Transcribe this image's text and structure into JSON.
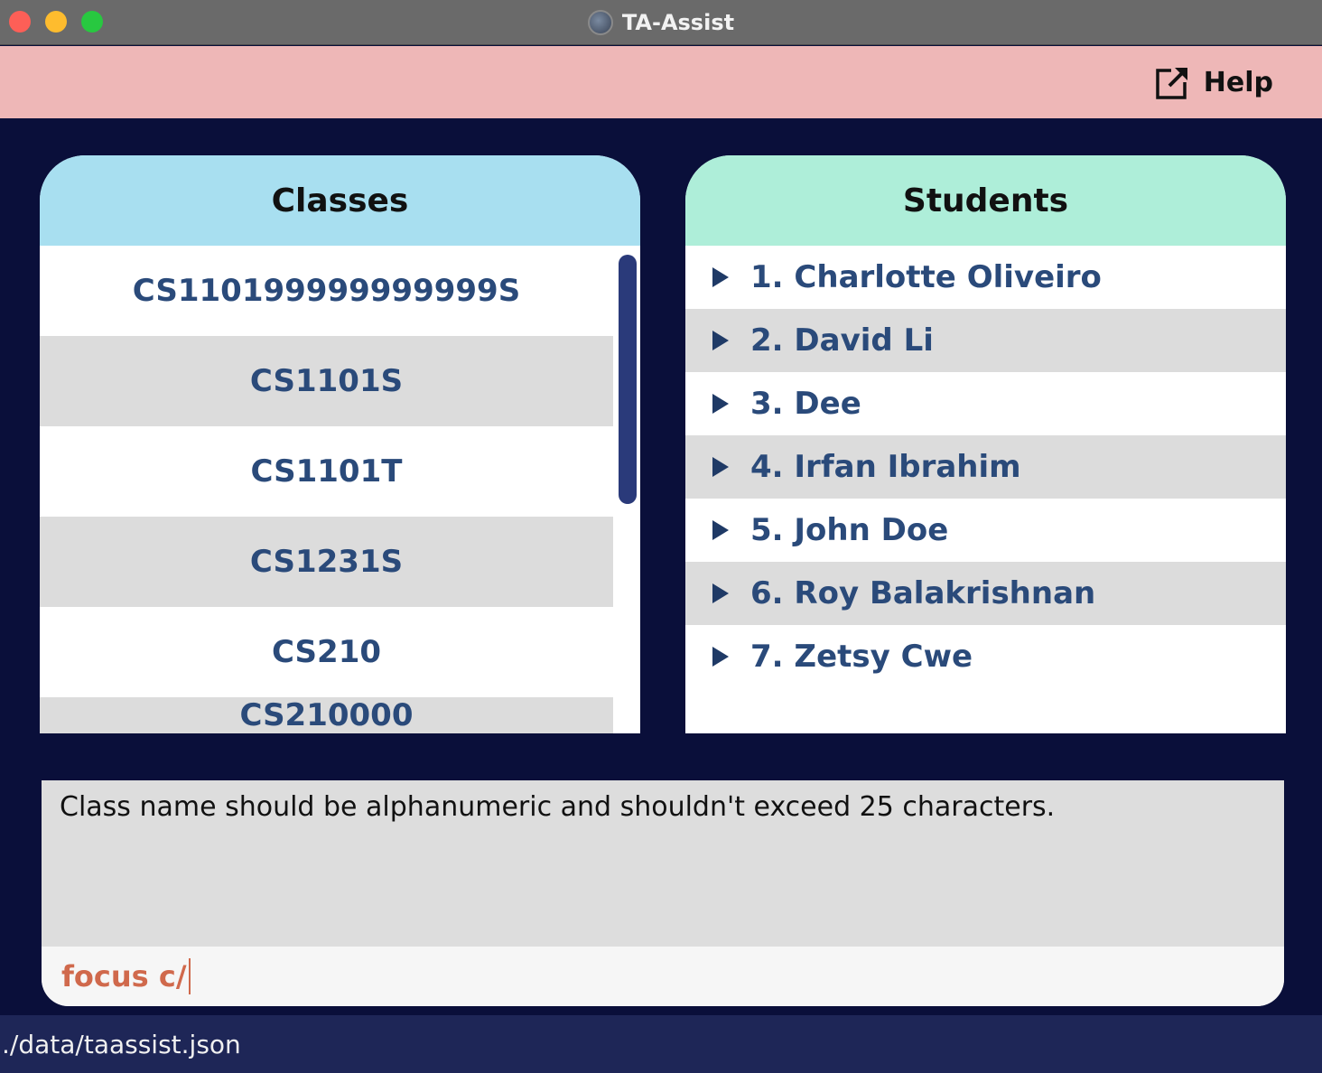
{
  "window": {
    "title": "TA-Assist"
  },
  "menu": {
    "help_label": "Help"
  },
  "classes_panel": {
    "header": "Classes",
    "items": [
      {
        "label": "CS110199999999999S"
      },
      {
        "label": "CS1101S"
      },
      {
        "label": "CS1101T"
      },
      {
        "label": "CS1231S"
      },
      {
        "label": "CS210"
      },
      {
        "label": "CS210000"
      }
    ]
  },
  "students_panel": {
    "header": "Students",
    "items": [
      {
        "label": "1. Charlotte Oliveiro"
      },
      {
        "label": "2. David Li"
      },
      {
        "label": "3. Dee"
      },
      {
        "label": "4. Irfan Ibrahim"
      },
      {
        "label": "5. John Doe"
      },
      {
        "label": "6. Roy Balakrishnan"
      },
      {
        "label": "7. Zetsy Cwe"
      }
    ]
  },
  "result": {
    "message": "Class name should be alphanumeric and shouldn't exceed 25 characters."
  },
  "command": {
    "value": "focus c/"
  },
  "status_bar": {
    "path": "./data/taassist.json"
  },
  "colors": {
    "background": "#0a0f3a",
    "menubar": "#eeb7b7",
    "classes_header": "#a8dff0",
    "students_header": "#aeeed9",
    "list_text": "#2a4a7a",
    "command_text": "#d0694c"
  }
}
